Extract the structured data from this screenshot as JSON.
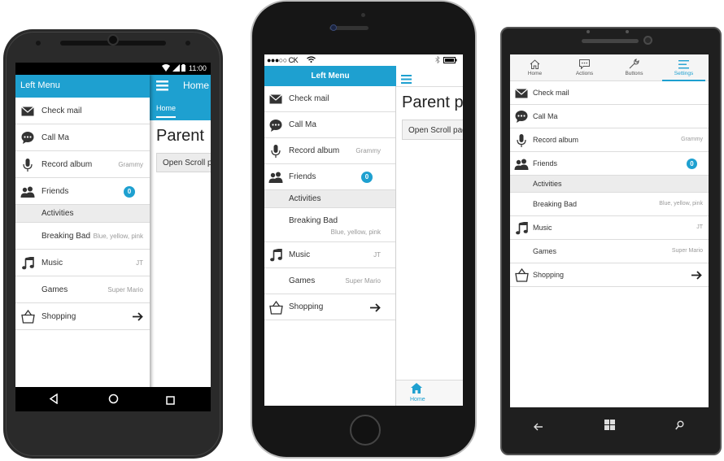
{
  "android": {
    "status_time": "11:00",
    "drawer_title": "Left Menu",
    "main_title": "Home",
    "tab_label": "Home",
    "page_heading": "Parent",
    "scroll_button": "Open Scroll p",
    "items": [
      {
        "label": "Check mail",
        "detail": "",
        "icon": "mail-icon"
      },
      {
        "label": "Call Ma",
        "detail": "",
        "icon": "chat-icon"
      },
      {
        "label": "Record album",
        "detail": "Grammy",
        "icon": "microphone-icon"
      },
      {
        "label": "Friends",
        "badge": "0",
        "icon": "people-icon"
      },
      {
        "label": "Activities",
        "section": true
      },
      {
        "label": "Breaking Bad",
        "detail": "Blue, yellow, pink"
      },
      {
        "label": "Music",
        "detail": "JT",
        "icon": "music-icon"
      },
      {
        "label": "Games",
        "detail": "Super Mario"
      },
      {
        "label": "Shopping",
        "icon": "bag-icon",
        "arrow": true
      }
    ]
  },
  "iphone": {
    "carrier": "●●●○○ CK",
    "drawer_title": "Left Menu",
    "page_heading": "Parent p",
    "scroll_button": "Open Scroll pag",
    "tab_label": "Home",
    "items": [
      {
        "label": "Check mail",
        "icon": "mail-icon"
      },
      {
        "label": "Call Ma",
        "icon": "chat-icon"
      },
      {
        "label": "Record album",
        "detail": "Grammy",
        "icon": "microphone-icon"
      },
      {
        "label": "Friends",
        "badge": "0",
        "icon": "people-icon"
      },
      {
        "label": "Activities",
        "section": true
      },
      {
        "label": "Breaking Bad",
        "detail": "Blue, yellow, pink",
        "twoline": true
      },
      {
        "label": "Music",
        "detail": "JT",
        "icon": "music-icon"
      },
      {
        "label": "Games",
        "detail": "Super Mario"
      },
      {
        "label": "Shopping",
        "icon": "bag-icon",
        "arrow": true
      }
    ]
  },
  "winphone": {
    "tabs": [
      {
        "label": "Home",
        "icon": "home-icon"
      },
      {
        "label": "Actions",
        "icon": "comment-icon"
      },
      {
        "label": "Buttons",
        "icon": "wrench-icon"
      },
      {
        "label": "Settings",
        "icon": "lines-icon",
        "active": true
      }
    ],
    "items": [
      {
        "label": "Check mail",
        "icon": "mail-icon"
      },
      {
        "label": "Call Ma",
        "icon": "chat-icon"
      },
      {
        "label": "Record album",
        "detail": "Grammy",
        "icon": "microphone-icon"
      },
      {
        "label": "Friends",
        "badge": "0",
        "icon": "people-icon"
      },
      {
        "label": "Activities",
        "section": true
      },
      {
        "label": "Breaking Bad",
        "detail": "Blue, yellow, pink"
      },
      {
        "label": "Music",
        "detail": "JT",
        "icon": "music-icon"
      },
      {
        "label": "Games",
        "detail": "Super Mario"
      },
      {
        "label": "Shopping",
        "icon": "bag-icon",
        "arrow": true
      }
    ]
  },
  "colors": {
    "accent": "#1ea0d0",
    "badge": "#1ea0d0",
    "section_bg": "#ececec"
  }
}
